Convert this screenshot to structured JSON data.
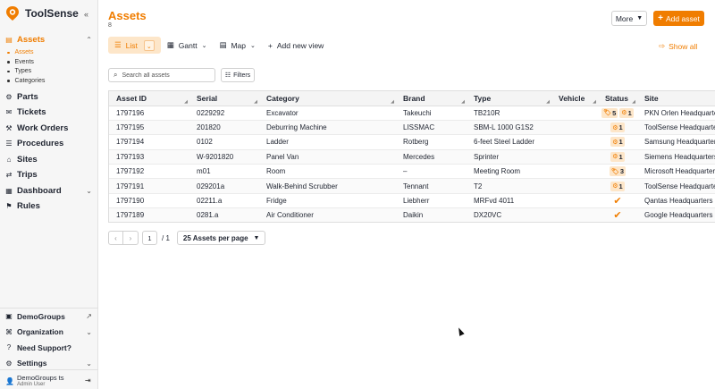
{
  "app": {
    "name": "ToolSense",
    "accent": "#f07d00"
  },
  "sidebar": {
    "collapse_icon": "«",
    "items": [
      {
        "label": "Assets",
        "icon": "assets-icon",
        "active": true,
        "expanded": true,
        "children": [
          {
            "label": "Assets",
            "active": true
          },
          {
            "label": "Events"
          },
          {
            "label": "Types"
          },
          {
            "label": "Categories"
          }
        ]
      },
      {
        "label": "Parts",
        "icon": "parts-icon"
      },
      {
        "label": "Tickets",
        "icon": "tickets-icon"
      },
      {
        "label": "Work Orders",
        "icon": "work-orders-icon"
      },
      {
        "label": "Procedures",
        "icon": "procedures-icon"
      },
      {
        "label": "Sites",
        "icon": "sites-icon"
      },
      {
        "label": "Trips",
        "icon": "trips-icon"
      },
      {
        "label": "Dashboard",
        "icon": "dashboard-icon"
      },
      {
        "label": "Rules",
        "icon": "rules-icon"
      }
    ],
    "bottom": [
      {
        "label": "DemoGroups",
        "icon": "groups-icon",
        "trailing": "↗"
      },
      {
        "label": "Organization",
        "icon": "organization-icon",
        "trailing": "⌄"
      },
      {
        "label": "Need Support?",
        "icon": "support-icon"
      },
      {
        "label": "Settings",
        "icon": "settings-icon",
        "trailing": "⌄"
      }
    ],
    "user": {
      "name": "DemoGroups ts",
      "role": "Admin User"
    }
  },
  "header": {
    "title": "Assets",
    "count": "8",
    "more_label": "More",
    "add_label": "Add asset"
  },
  "views": {
    "tabs": [
      {
        "label": "List",
        "active": true
      },
      {
        "label": "Gantt"
      },
      {
        "label": "Map"
      }
    ],
    "add_view_label": "Add new view",
    "show_all_label": "Show all"
  },
  "search": {
    "placeholder": "Search all assets",
    "value": ""
  },
  "filters_label": "Filters",
  "table": {
    "columns": [
      "Asset ID",
      "Serial",
      "Category",
      "Brand",
      "Type",
      "Vehicle",
      "Status",
      "Site"
    ],
    "rows": [
      {
        "id": "1797196",
        "serial": "0229292",
        "category": "Excavator",
        "brand": "Takeuchi",
        "type": "TB210R",
        "vehicle": "",
        "status": [
          {
            "icon": "tag-icon",
            "count": "5"
          },
          {
            "icon": "gear-icon",
            "count": "1"
          }
        ],
        "site": "PKN Orlen Headquarters"
      },
      {
        "id": "1797195",
        "serial": "201820",
        "category": "Deburring Machine",
        "brand": "LISSMAC",
        "type": "SBM-L 1000 G1S2",
        "vehicle": "",
        "status": [
          {
            "icon": "gear-icon",
            "count": "1"
          }
        ],
        "site": "ToolSense Headquarters"
      },
      {
        "id": "1797194",
        "serial": "0102",
        "category": "Ladder",
        "brand": "Rotberg",
        "type": "6-feet Steel Ladder",
        "vehicle": "",
        "status": [
          {
            "icon": "gear-icon",
            "count": "1"
          }
        ],
        "site": "Samsung Headquarters"
      },
      {
        "id": "1797193",
        "serial": "W-9201820",
        "category": "Panel Van",
        "brand": "Mercedes",
        "type": "Sprinter",
        "vehicle": "",
        "status": [
          {
            "icon": "gear-icon",
            "count": "1"
          }
        ],
        "site": "Siemens Headquarters"
      },
      {
        "id": "1797192",
        "serial": "m01",
        "category": "Room",
        "brand": "–",
        "type": "Meeting Room",
        "vehicle": "",
        "status": [
          {
            "icon": "tag-icon",
            "count": "3"
          }
        ],
        "site": "Microsoft Headquarters"
      },
      {
        "id": "1797191",
        "serial": "029201a",
        "category": "Walk-Behind Scrubber",
        "brand": "Tennant",
        "type": "T2",
        "vehicle": "",
        "status": [
          {
            "icon": "gear-icon",
            "count": "1"
          }
        ],
        "site": "ToolSense Headquarters"
      },
      {
        "id": "1797190",
        "serial": "02211.a",
        "category": "Fridge",
        "brand": "Liebherr",
        "type": "MRFvd 4011",
        "vehicle": "",
        "status": "ok",
        "site": "Qantas Headquarters"
      },
      {
        "id": "1797189",
        "serial": "0281.a",
        "category": "Air Conditioner",
        "brand": "Daikin",
        "type": "DX20VC",
        "vehicle": "",
        "status": "ok",
        "site": "Google Headquarters"
      }
    ]
  },
  "pagination": {
    "page": "1",
    "of_label": "/ 1",
    "per_page_label": "25 Assets per page"
  }
}
